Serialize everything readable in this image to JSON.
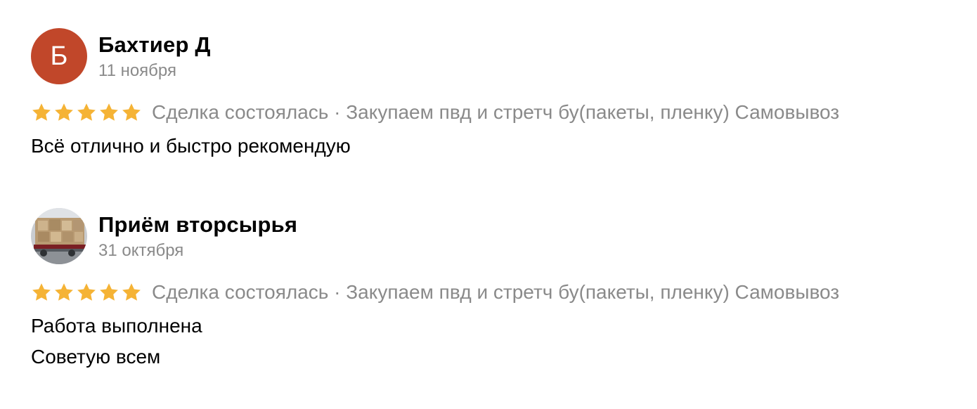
{
  "reviews": [
    {
      "author": "Бахтиер Д",
      "avatar_letter": "Б",
      "avatar_color": "#c1472a",
      "date": "11 ноября",
      "rating": 5,
      "deal_status": "Сделка состоялась · Закупаем пвд и стретч бу(пакеты, пленку) Самовывоз",
      "text_lines": [
        "Всё отлично и быстро рекомендую"
      ]
    },
    {
      "author": "Приём вторсырья",
      "avatar_type": "photo",
      "date": "31 октября",
      "rating": 5,
      "deal_status": "Сделка состоялась · Закупаем пвд и стретч бу(пакеты, пленку) Самовывоз",
      "text_lines": [
        "Работа выполнена",
        "Советую всем"
      ]
    }
  ],
  "colors": {
    "star": "#f5b335",
    "secondary_text": "#8a8a8a"
  },
  "icons": {
    "star": "star-icon"
  }
}
